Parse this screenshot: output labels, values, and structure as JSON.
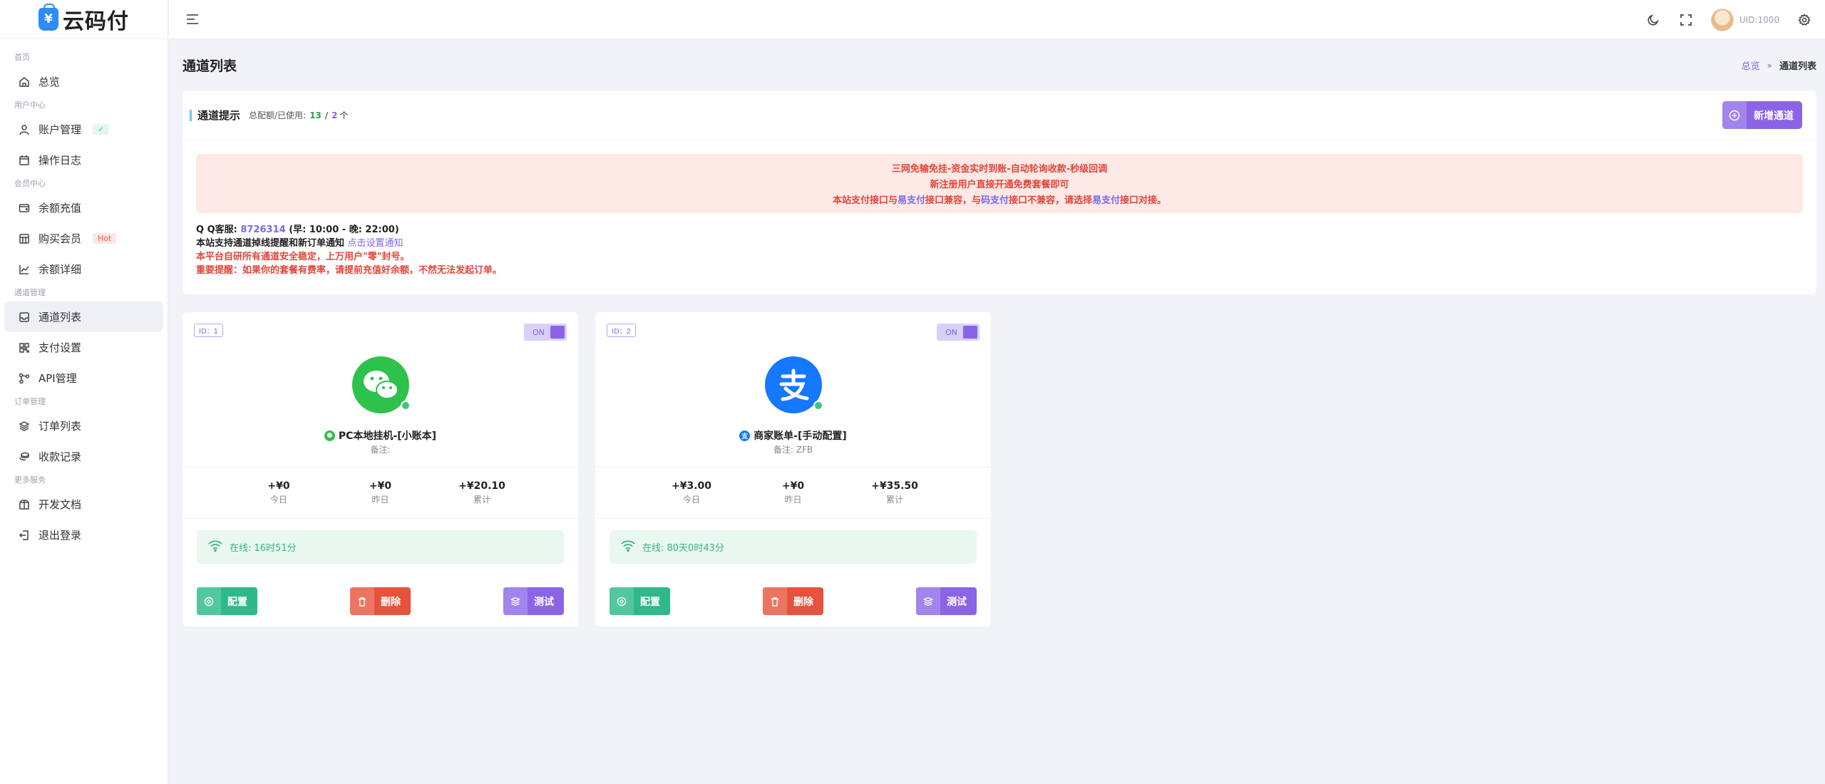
{
  "brand": {
    "logo_symbol": "¥",
    "name": "云码付"
  },
  "sidebar": {
    "sections": [
      {
        "label": "首页",
        "items": [
          {
            "label": "总览",
            "icon": "home-icon"
          }
        ]
      },
      {
        "label": "用户中心",
        "items": [
          {
            "label": "账户管理",
            "icon": "user-icon",
            "badge": "✓"
          },
          {
            "label": "操作日志",
            "icon": "calendar-icon"
          }
        ]
      },
      {
        "label": "会员中心",
        "items": [
          {
            "label": "余额充值",
            "icon": "wallet-icon"
          },
          {
            "label": "购买会员",
            "icon": "store-icon",
            "badge": "Hot"
          },
          {
            "label": "余额详细",
            "icon": "chart-line-icon"
          }
        ]
      },
      {
        "label": "通道管理",
        "items": [
          {
            "label": "通道列表",
            "icon": "inbox-icon",
            "active": true
          },
          {
            "label": "支付设置",
            "icon": "grid-icon"
          },
          {
            "label": "API管理",
            "icon": "nodes-icon"
          }
        ]
      },
      {
        "label": "订单管理",
        "items": [
          {
            "label": "订单列表",
            "icon": "layers-icon"
          },
          {
            "label": "收款记录",
            "icon": "coins-icon"
          }
        ]
      },
      {
        "label": "更多服务",
        "items": [
          {
            "label": "开发文档",
            "icon": "package-icon"
          },
          {
            "label": "退出登录",
            "icon": "logout-icon"
          }
        ]
      }
    ]
  },
  "header": {
    "uid": "UID:1000"
  },
  "page": {
    "title": "通道列表",
    "breadcrumb": {
      "home": "总览",
      "separator": "»",
      "current": "通道列表"
    }
  },
  "notice": {
    "title": "通道提示",
    "quota_label": "总配额/已使用:",
    "quota_used": "13",
    "quota_sep": "/",
    "quota_total": "2",
    "quota_unit": "个",
    "add_button": "新增通道",
    "alert": {
      "line1": "三网免输免挂-资金实时到账-自动轮询收款-秒级回调",
      "line2": "新注册用户直接开通免费套餐即可",
      "line3_a": "本站支付接口与",
      "line3_b": "易支付",
      "line3_c": "接口兼容，与",
      "line3_d": "码支付",
      "line3_e": "接口不兼容，请选择",
      "line3_f": "易支付",
      "line3_g": "接口对接。"
    },
    "qq_label": "Q Q客服:",
    "qq_number": "8726314",
    "qq_hours": "(早: 10:00 - 晚: 22:00)",
    "support_text": "本站支持通道掉线提醒和新订单通知",
    "support_link": "点击设置通知",
    "safety_text": "本平台自研所有通道安全稳定，上万用户\"零\"封号。",
    "important_text": "重要提醒：如果你的套餐有费率，请提前充值好余额，不然无法发起订单。"
  },
  "channels": [
    {
      "id_tag": "ID：1",
      "toggle": "ON",
      "type": "wechat",
      "name": "PC本地挂机-[小账本]",
      "remark": "备注:",
      "stats": [
        {
          "value": "+¥0",
          "label": "今日"
        },
        {
          "value": "+¥0",
          "label": "昨日"
        },
        {
          "value": "+¥20.10",
          "label": "累计"
        }
      ],
      "online": "在线: 16时51分",
      "buttons": {
        "config": "配置",
        "delete": "删除",
        "test": "测试"
      }
    },
    {
      "id_tag": "ID：2",
      "toggle": "ON",
      "type": "alipay",
      "name": "商家账单-[手动配置]",
      "remark": "备注: ZFB",
      "stats": [
        {
          "value": "+¥3.00",
          "label": "今日"
        },
        {
          "value": "+¥0",
          "label": "昨日"
        },
        {
          "value": "+¥35.50",
          "label": "累计"
        }
      ],
      "online": "在线: 80天0时43分",
      "buttons": {
        "config": "配置",
        "delete": "删除",
        "test": "测试"
      }
    }
  ],
  "colors": {
    "accent": "#8b64e6",
    "link": "#7b68ee",
    "danger": "#e2463b",
    "success": "#2fb888"
  }
}
